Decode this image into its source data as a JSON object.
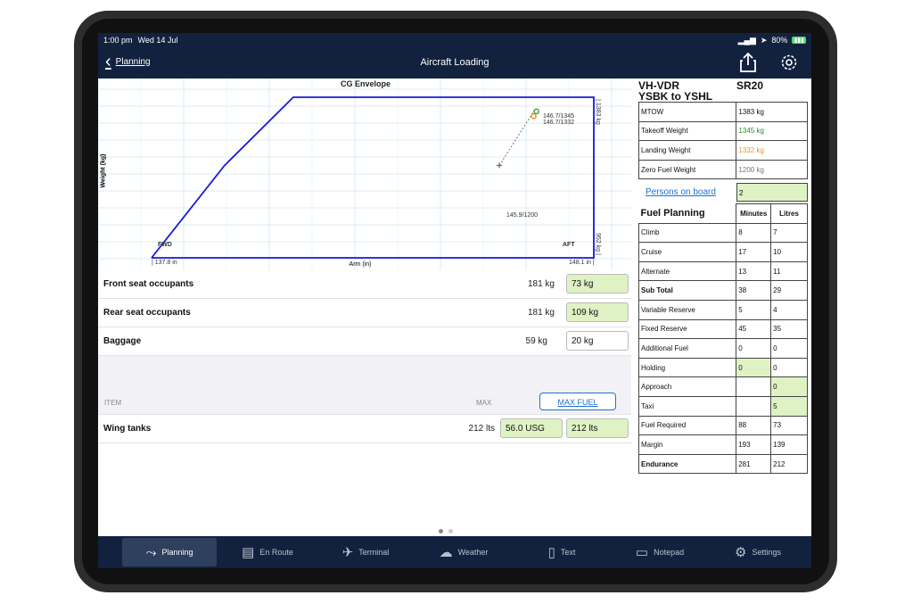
{
  "status": {
    "time": "1:00 pm",
    "date": "Wed 14 Jul",
    "battery": "80%"
  },
  "nav": {
    "back_label": "Planning",
    "title": "Aircraft Loading"
  },
  "chart_data": {
    "type": "scatter",
    "title": "CG Envelope",
    "xlabel": "Arm (in)",
    "ylabel": "Weight (kg)",
    "xlim": [
      137.8,
      148.1
    ],
    "ylim": [
      952,
      1383
    ],
    "envelope": {
      "name": "",
      "x": [
        137.8,
        139.5,
        141.1,
        148.1,
        148.1,
        137.8
      ],
      "y": [
        952,
        1200,
        1383,
        1383,
        952,
        952
      ]
    },
    "points": [
      {
        "label": "146.7/1345",
        "x": 146.7,
        "y": 1345,
        "color": "#3a9a3a"
      },
      {
        "label": "146.7/1332",
        "x": 146.7,
        "y": 1332,
        "color": "#f0901e"
      },
      {
        "label": "145.9/1200",
        "x": 145.9,
        "y": 1200,
        "color": "#666666"
      }
    ],
    "annotations": {
      "fwd": "FWD",
      "aft": "AFT",
      "x_min": "| 137.8 in",
      "x_max": "148.1 in |",
      "y_max": "| 1383 kg",
      "y_min": "952 kg |"
    }
  },
  "loading": {
    "rows": [
      {
        "name": "Front seat occupants",
        "max": "181 kg",
        "value": "73 kg",
        "style": "green"
      },
      {
        "name": "Rear seat occupants",
        "max": "181 kg",
        "value": "109 kg",
        "style": "green"
      },
      {
        "name": "Baggage",
        "max": "59 kg",
        "value": "20 kg",
        "style": "white"
      }
    ],
    "header": {
      "item": "ITEM",
      "max": "MAX",
      "max_fuel_button": "MAX FUEL"
    },
    "fuel_row": {
      "name": "Wing tanks",
      "max": "212 lts",
      "usg": "56.0 USG",
      "value": "212 lts"
    }
  },
  "weights": {
    "registration": "VH-VDR",
    "type": "SR20",
    "route": "YSBK to YSHL",
    "rows": [
      {
        "label": "MTOW",
        "value": "1383 kg",
        "color": "#111111"
      },
      {
        "label": "Takeoff Weight",
        "value": "1345 kg",
        "color": "#2e8b2e"
      },
      {
        "label": "Landing Weight",
        "value": "1332 kg",
        "color": "#f0901e"
      },
      {
        "label": "Zero Fuel Weight",
        "value": "1200 kg",
        "color": "#777777"
      }
    ],
    "persons_label": "Persons on board",
    "persons_value": "2"
  },
  "fuel_planning": {
    "title": "Fuel Planning",
    "col_minutes": "Minutes",
    "col_litres": "Litres",
    "rows": [
      {
        "label": "Climb",
        "minutes": "8",
        "litres": "7",
        "bold": false,
        "min_green": false,
        "lit_green": false
      },
      {
        "label": "Cruise",
        "minutes": "17",
        "litres": "10",
        "bold": false,
        "min_green": false,
        "lit_green": false
      },
      {
        "label": "Alternate",
        "minutes": "13",
        "litres": "11",
        "bold": false,
        "min_green": false,
        "lit_green": false
      },
      {
        "label": "Sub Total",
        "minutes": "38",
        "litres": "29",
        "bold": true,
        "min_green": false,
        "lit_green": false
      },
      {
        "label": "Variable Reserve",
        "minutes": "5",
        "litres": "4",
        "bold": false,
        "min_green": false,
        "lit_green": false
      },
      {
        "label": "Fixed Reserve",
        "minutes": "45",
        "litres": "35",
        "bold": false,
        "min_green": false,
        "lit_green": false
      },
      {
        "label": "Additional Fuel",
        "minutes": "0",
        "litres": "0",
        "bold": false,
        "min_green": false,
        "lit_green": false
      },
      {
        "label": "Holding",
        "minutes": "0",
        "litres": "0",
        "bold": false,
        "min_green": true,
        "lit_green": false
      },
      {
        "label": "Approach",
        "minutes": "",
        "litres": "0",
        "bold": false,
        "min_green": false,
        "lit_green": true
      },
      {
        "label": "Taxi",
        "minutes": "",
        "litres": "5",
        "bold": false,
        "min_green": false,
        "lit_green": true
      },
      {
        "label": "Fuel Required",
        "minutes": "88",
        "litres": "73",
        "bold": false,
        "min_green": false,
        "lit_green": false
      },
      {
        "label": "Margin",
        "minutes": "193",
        "litres": "139",
        "bold": false,
        "min_green": false,
        "lit_green": false
      },
      {
        "label": "Endurance",
        "minutes": "281",
        "litres": "212",
        "bold": true,
        "min_green": false,
        "lit_green": false
      }
    ]
  },
  "tabs": [
    {
      "label": "Planning",
      "icon": "route-icon",
      "active": true
    },
    {
      "label": "En Route",
      "icon": "map-icon",
      "active": false
    },
    {
      "label": "Terminal",
      "icon": "airplane-icon",
      "active": false
    },
    {
      "label": "Weather",
      "icon": "cloud-icon",
      "active": false
    },
    {
      "label": "Text",
      "icon": "document-icon",
      "active": false
    },
    {
      "label": "Notepad",
      "icon": "notepad-icon",
      "active": false
    },
    {
      "label": "Settings",
      "icon": "gear-icon",
      "active": false
    }
  ],
  "colors": {
    "bar": "#12223e",
    "envelope": "#1a1ad6",
    "input_green": "#dff2c4",
    "link": "#1f6fd1"
  }
}
